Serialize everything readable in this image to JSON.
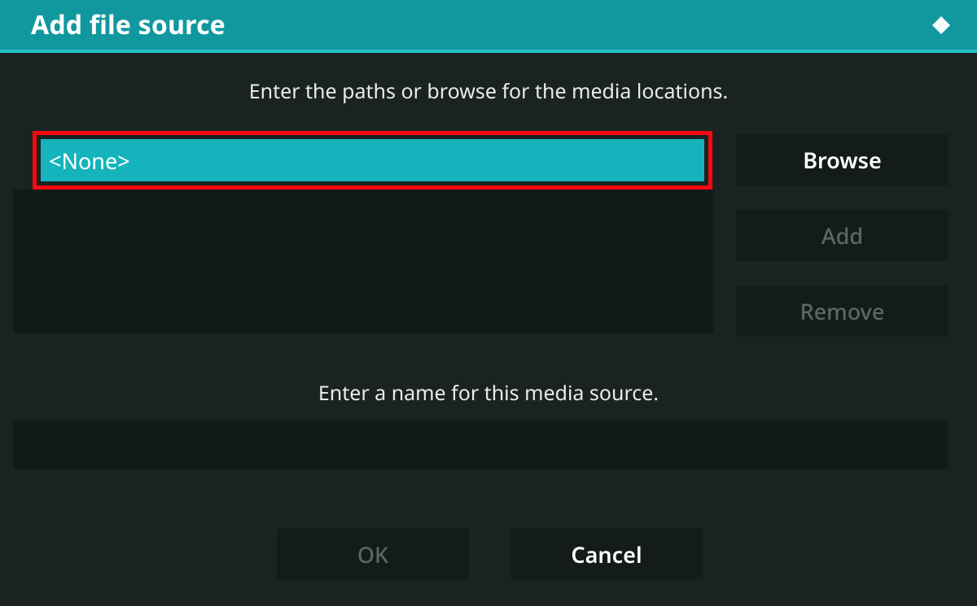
{
  "header": {
    "title": "Add file source"
  },
  "dialog": {
    "instr_paths": "Enter the paths or browse for the media locations.",
    "instr_name": "Enter a name for this media source.",
    "path_value": "<None>",
    "name_value": ""
  },
  "buttons": {
    "browse": "Browse",
    "add": "Add",
    "remove": "Remove",
    "ok": "OK",
    "cancel": "Cancel"
  },
  "icons": {
    "logo": "kodi-logo"
  },
  "colors": {
    "accent": "#11989f",
    "accent_light": "#22c2cb",
    "selected": "#15b4bd",
    "highlight": "#f70910",
    "panel": "#1a2321",
    "field": "#121b19",
    "button": "#141c1b",
    "text": "#ffffff",
    "text_muted": "#5d6664"
  }
}
